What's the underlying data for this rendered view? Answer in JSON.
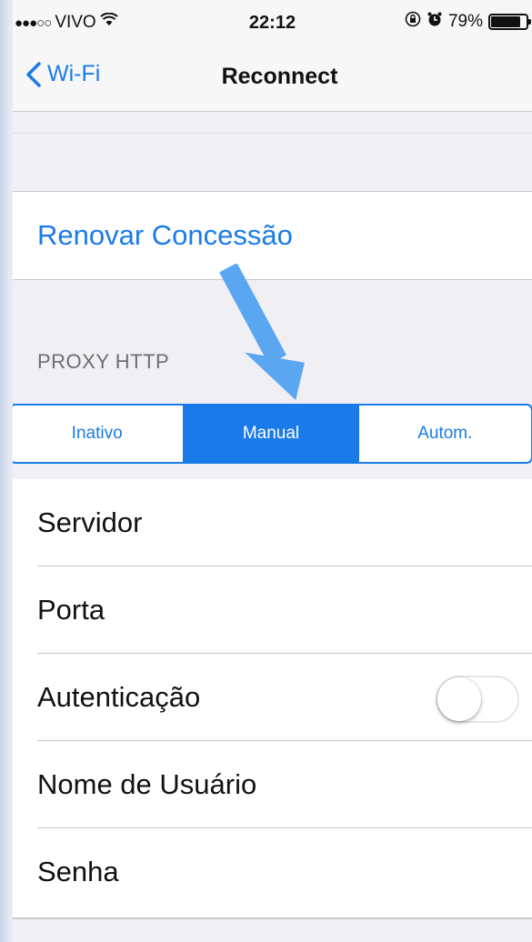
{
  "status_bar": {
    "carrier": "VIVO",
    "signal_dots": "●●●○○",
    "time": "22:12",
    "battery": "79%",
    "battery_level": 0.79
  },
  "nav": {
    "back_label": "Wi-Fi",
    "title": "Reconnect"
  },
  "renew_lease": "Renovar Concessão",
  "proxy": {
    "header": "PROXY HTTP",
    "segments": [
      "Inativo",
      "Manual",
      "Autom."
    ],
    "selected": "Manual"
  },
  "rows": {
    "server": "Servidor",
    "port": "Porta",
    "auth": "Autenticação",
    "auth_enabled": false,
    "username": "Nome de Usuário",
    "password": "Senha"
  },
  "colors": {
    "accent": "#1a7be8",
    "annotation_arrow": "#5aa6f0"
  }
}
